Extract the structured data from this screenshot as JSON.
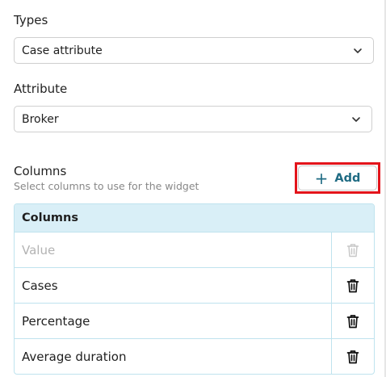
{
  "types": {
    "label": "Types",
    "selected": "Case attribute"
  },
  "attribute": {
    "label": "Attribute",
    "selected": "Broker"
  },
  "columns_section": {
    "title": "Columns",
    "subtitle": "Select columns to use for the widget",
    "add_button": {
      "icon": "plus-icon",
      "label": "Add"
    }
  },
  "table": {
    "header": "Columns",
    "rows": [
      {
        "value": "Value",
        "placeholder": true,
        "delete_enabled": false
      },
      {
        "value": "Cases",
        "placeholder": false,
        "delete_enabled": true
      },
      {
        "value": "Percentage",
        "placeholder": false,
        "delete_enabled": true
      },
      {
        "value": "Average duration",
        "placeholder": false,
        "delete_enabled": true
      }
    ]
  },
  "colors": {
    "accent": "#1f6b83",
    "highlight": "#e3141b",
    "table_border": "#bfe3ee",
    "table_header_bg": "#d9eff7"
  }
}
